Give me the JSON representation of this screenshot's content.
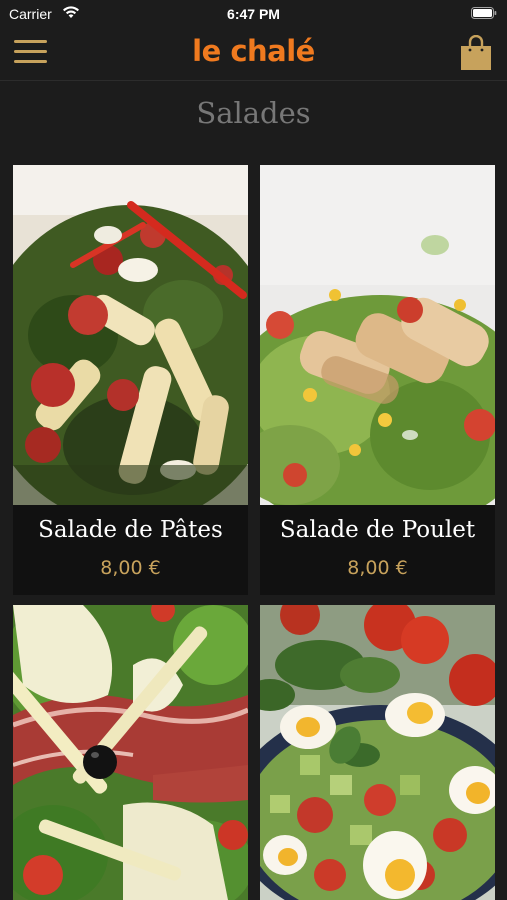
{
  "status": {
    "carrier": "Carrier",
    "time": "6:47 PM"
  },
  "header": {
    "logo": "le chalé",
    "menu_icon": "hamburger-menu-icon",
    "cart_icon": "shopping-bag-icon",
    "accent_color": "#c7a25c",
    "brand_color": "#f07a1f"
  },
  "page": {
    "title": "Salades"
  },
  "products": [
    {
      "name": "Salade de Pâtes",
      "price": "8,00 €",
      "image": "pasta-salad-photo"
    },
    {
      "name": "Salade de Poulet",
      "price": "8,00 €",
      "image": "chicken-salad-photo"
    },
    {
      "name": "",
      "price": "",
      "image": "ham-cheese-salad-photo"
    },
    {
      "name": "",
      "price": "",
      "image": "egg-tomato-salad-photo"
    }
  ]
}
